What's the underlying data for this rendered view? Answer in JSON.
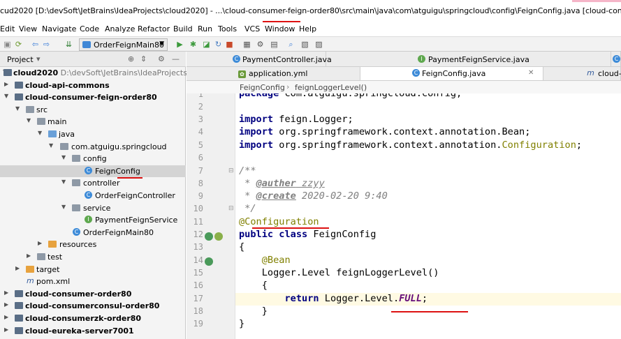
{
  "window": {
    "title": "cud2020 [D:\\devSoft\\JetBrains\\IdeaProjects\\cloud2020] - ...\\cloud-consumer-feign-order80\\src\\main\\java\\com\\atguigu\\springcloud\\config\\FeignConfig.java [cloud-consumer-feign-ord"
  },
  "menu": {
    "items": [
      "Edit",
      "View",
      "Navigate",
      "Code",
      "Analyze",
      "Refactor",
      "Build",
      "Run",
      "Tools",
      "VCS",
      "Window",
      "Help"
    ]
  },
  "toolbar": {
    "run_config": "OrderFeignMain80"
  },
  "project_panel": {
    "title": "Project",
    "tree": [
      {
        "label": "cloud2020",
        "path": "D:\\devSoft\\JetBrains\\IdeaProjects\\cloud"
      },
      {
        "label": "cloud-api-commons"
      },
      {
        "label": "cloud-consumer-feign-order80"
      },
      {
        "label": "src"
      },
      {
        "label": "main"
      },
      {
        "label": "java"
      },
      {
        "label": "com.atguigu.springcloud"
      },
      {
        "label": "config"
      },
      {
        "label": "FeignConfig"
      },
      {
        "label": "controller"
      },
      {
        "label": "OrderFeignController"
      },
      {
        "label": "service"
      },
      {
        "label": "PaymentFeignService"
      },
      {
        "label": "OrderFeignMain80"
      },
      {
        "label": "resources"
      },
      {
        "label": "test"
      },
      {
        "label": "target"
      },
      {
        "label": "pom.xml"
      },
      {
        "label": "cloud-consumer-order80"
      },
      {
        "label": "cloud-consumerconsul-order80"
      },
      {
        "label": "cloud-consumerzk-order80"
      },
      {
        "label": "cloud-eureka-server7001"
      }
    ]
  },
  "tabs": {
    "row1": [
      "PaymentController.java",
      "PaymentFeignService.java"
    ],
    "row2": [
      "application.yml",
      "FeignConfig.java",
      "cloud-"
    ]
  },
  "breadcrumb": {
    "class_name": "FeignConfig",
    "method_name": "feignLoggerLevel()"
  },
  "editor": {
    "line_numbers": [
      "1",
      "2",
      "3",
      "4",
      "5",
      "6",
      "7",
      "8",
      "9",
      "10",
      "11",
      "12",
      "13",
      "14",
      "15",
      "16",
      "17",
      "18",
      "19"
    ],
    "lines": {
      "l1_kw": "package",
      "l1_rest": " com.atguigu.springcloud.config;",
      "l3_kw": "import",
      "l3_rest": " feign.Logger;",
      "l4_kw": "import",
      "l4_rest": " org.springframework.context.annotation.Bean;",
      "l5_kw": "import",
      "l5_rest": " org.springframework.context.annotation.",
      "l5_cfg": "Configuration",
      "l5_end": ";",
      "l7": "/**",
      "l8_star": " * ",
      "l8_tag": "@auther",
      "l8_val": " zzyy",
      "l9_star": " * ",
      "l9_tag": "@create",
      "l9_val": " 2020-02-20 9:40",
      "l10": " */",
      "l11": "@Configuration",
      "l12_kw": "public class",
      "l12_rest": " FeignConfig",
      "l13": "{",
      "l14": "    @Bean",
      "l15": "    Logger.Level feignLoggerLevel()",
      "l16": "    {",
      "l17_indent": "        ",
      "l17_kw": "return",
      "l17_rest": " Logger.Level.",
      "l17_full": "FULL",
      "l17_end": ";",
      "l18": "    }",
      "l19": "}"
    }
  },
  "colors": {
    "keyword": "#000080",
    "annotation": "#808000",
    "comment": "#808080",
    "constant": "#660e7a",
    "markup_red": "#dd1111"
  }
}
